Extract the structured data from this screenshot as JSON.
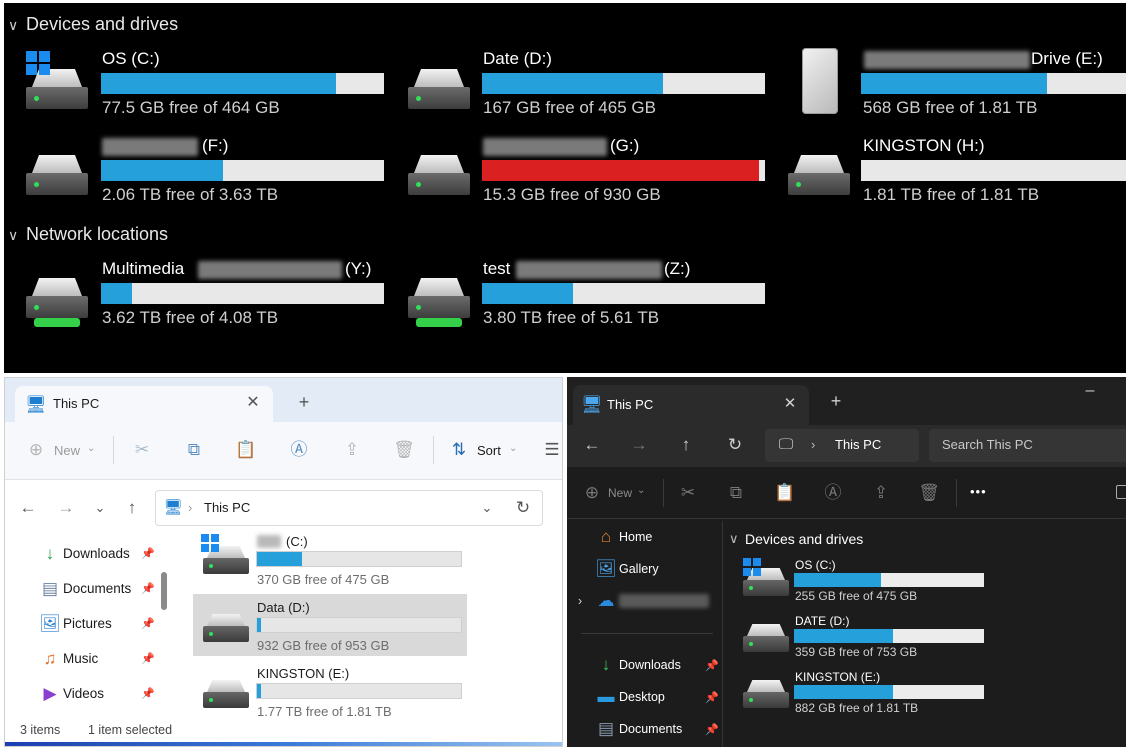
{
  "top_panel": {
    "devices_heading": "Devices and drives",
    "network_heading": "Network locations",
    "drives": [
      {
        "name": "OS (C:)",
        "size": "77.5 GB free of 464 GB",
        "used_fraction": 0.83,
        "status": "normal"
      },
      {
        "name": "Date (D:)",
        "size": "167 GB free of 465 GB",
        "used_fraction": 0.64,
        "status": "normal"
      },
      {
        "name": "Drive (E:)",
        "size": "568 GB free of 1.81 TB",
        "used_fraction": 0.69,
        "status": "normal"
      },
      {
        "name": "(F:)",
        "size": "2.06 TB free of 3.63 TB",
        "used_fraction": 0.43,
        "status": "normal"
      },
      {
        "name": "(G:)",
        "size": "15.3 GB free of 930 GB",
        "used_fraction": 0.98,
        "status": "critical"
      },
      {
        "name": "KINGSTON (H:)",
        "size": "1.81 TB free of 1.81 TB",
        "used_fraction": 0.0,
        "status": "normal"
      }
    ],
    "network": [
      {
        "name_prefix": "Multimedia",
        "name_suffix": "(Y:)",
        "size": "3.62 TB free of 4.08 TB",
        "used_fraction": 0.11
      },
      {
        "name_prefix": "test",
        "name_suffix": "(Z:)",
        "size": "3.80 TB free of 5.61 TB",
        "used_fraction": 0.32
      }
    ]
  },
  "light_explorer": {
    "tab_title": "This PC",
    "toolbar": {
      "new_label": "New",
      "sort_label": "Sort"
    },
    "address": "This PC",
    "nav_items": [
      "Downloads",
      "Documents",
      "Pictures",
      "Music",
      "Videos"
    ],
    "drives": [
      {
        "name": "(C:)",
        "size": "370 GB free of 475 GB",
        "used_fraction": 0.22
      },
      {
        "name": "Data (D:)",
        "size": "932 GB free of 953 GB",
        "used_fraction": 0.02
      },
      {
        "name": "KINGSTON (E:)",
        "size": "1.77 TB free of 1.81 TB",
        "used_fraction": 0.02
      }
    ],
    "status": {
      "items": "3 items",
      "selected": "1 item selected"
    }
  },
  "dark_explorer": {
    "tab_title": "This PC",
    "address": "This PC",
    "search_placeholder": "Search This PC",
    "toolbar": {
      "new_label": "New",
      "more_label": "•••"
    },
    "nav_top": [
      "Home",
      "Gallery"
    ],
    "nav_items": [
      "Downloads",
      "Desktop",
      "Documents"
    ],
    "section_heading": "Devices and drives",
    "drives": [
      {
        "name": "OS (C:)",
        "size": "255 GB free of 475 GB",
        "used_fraction": 0.46
      },
      {
        "name": "DATE (D:)",
        "size": "359 GB free of 753 GB",
        "used_fraction": 0.52
      },
      {
        "name": "KINGSTON (E:)",
        "size": "882 GB free of 1.81 TB",
        "used_fraction": 0.52
      }
    ]
  },
  "colors": {
    "bar_fill": "#26a0da",
    "bar_critical": "#da2020",
    "bar_track": "#e8e8e8"
  }
}
